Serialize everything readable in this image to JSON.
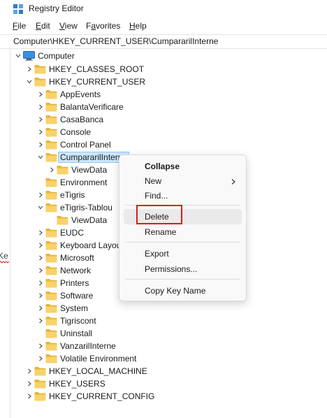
{
  "window": {
    "title": "Registry Editor"
  },
  "menu": [
    {
      "label_first": "F",
      "label_rest": "ile"
    },
    {
      "label_first": "E",
      "label_rest": "dit"
    },
    {
      "label_first": "V",
      "label_rest": "iew"
    },
    {
      "label_first": "",
      "label_rest": "Favorites",
      "underline_index": 1
    },
    {
      "label_first": "H",
      "label_rest": "elp"
    }
  ],
  "favorites_menu": {
    "pre": "F",
    "acc": "a",
    "post": "vorites"
  },
  "address": {
    "path": "Computer\\HKEY_CURRENT_USER\\CumpararilInterne"
  },
  "left_strip": {
    "text": "Ke"
  },
  "tree": {
    "root": "Computer",
    "rows": [
      {
        "label": "HKEY_CLASSES_ROOT",
        "expanded": false
      },
      {
        "label": "HKEY_CURRENT_USER",
        "expanded": true
      },
      {
        "label": "AppEvents",
        "expanded": false
      },
      {
        "label": "BalantaVerificare",
        "expanded": false
      },
      {
        "label": "CasaBanca",
        "expanded": false
      },
      {
        "label": "Console",
        "expanded": false
      },
      {
        "label": "Control Panel",
        "expanded": false
      },
      {
        "label": "CumpararilInterne",
        "expanded": true,
        "selected": true
      },
      {
        "label": "ViewData",
        "expanded": false
      },
      {
        "label": "Environment",
        "expanded": null
      },
      {
        "label": "eTigris",
        "expanded": false
      },
      {
        "label": "eTigris-Tablou",
        "expanded": true
      },
      {
        "label": "ViewData",
        "expanded": null
      },
      {
        "label": "EUDC",
        "expanded": false
      },
      {
        "label": "Keyboard Layout",
        "expanded": false
      },
      {
        "label": "Microsoft",
        "expanded": false
      },
      {
        "label": "Network",
        "expanded": false
      },
      {
        "label": "Printers",
        "expanded": false
      },
      {
        "label": "Software",
        "expanded": false
      },
      {
        "label": "System",
        "expanded": false
      },
      {
        "label": "Tigriscont",
        "expanded": false
      },
      {
        "label": "Uninstall",
        "expanded": null
      },
      {
        "label": "VanzarilInterne",
        "expanded": false
      },
      {
        "label": "Volatile Environment",
        "expanded": false
      },
      {
        "label": "HKEY_LOCAL_MACHINE",
        "expanded": false
      },
      {
        "label": "HKEY_USERS",
        "expanded": false
      },
      {
        "label": "HKEY_CURRENT_CONFIG",
        "expanded": false
      }
    ]
  },
  "context_menu": {
    "items": [
      {
        "label": "Collapse",
        "bold": true
      },
      {
        "label": "New",
        "submenu": true
      },
      {
        "label": "Find..."
      },
      {
        "label": "Delete",
        "highlighted": true
      },
      {
        "label": "Rename"
      },
      {
        "label": "Export"
      },
      {
        "label": "Permissions..."
      },
      {
        "label": "Copy Key Name"
      }
    ]
  },
  "colors": {
    "folder": "#f8d26a",
    "folder_dark": "#e8b43a",
    "selection": "#cce8ff",
    "annotation_red": "#e3161b",
    "accent_blue": "#0067c0"
  },
  "icons": {
    "app": "registry-editor-icon",
    "computer": "computer-icon",
    "folder": "folder-icon",
    "chevron_right": "chevron-right-icon",
    "chevron_down": "chevron-down-icon"
  }
}
